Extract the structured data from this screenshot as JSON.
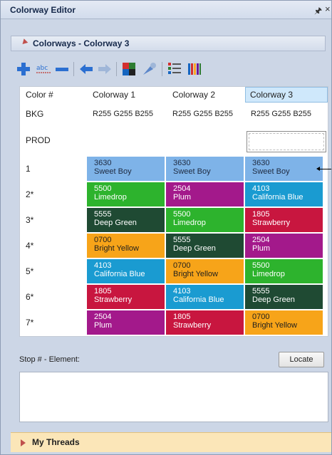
{
  "window": {
    "title": "Colorway Editor",
    "pin_glyph": "1",
    "close_glyph": "×"
  },
  "section": {
    "label": "Colorways - Colorway 3"
  },
  "toolbar": {
    "icons": [
      "add-icon",
      "rename-icon",
      "remove-icon",
      "arrow-left-icon",
      "arrow-right-icon",
      "colorway-grid-icon",
      "color-picker-icon",
      "list-icon",
      "palette-icon"
    ]
  },
  "grid": {
    "headers": [
      "Color #",
      "Colorway 1",
      "Colorway 2",
      "Colorway 3"
    ],
    "bkg": {
      "label": "BKG",
      "values": [
        "R255 G255 B255",
        "R255 G255 B255",
        "R255 G255 B255"
      ]
    },
    "prod": {
      "label": "PROD"
    },
    "rows": [
      {
        "label": "1",
        "cells": [
          {
            "code": "3630",
            "name": "Sweet Boy",
            "color": "#7eb3e8",
            "text": "#1e2a40"
          },
          {
            "code": "3630",
            "name": "Sweet Boy",
            "color": "#7eb3e8",
            "text": "#1e2a40"
          },
          {
            "code": "3630",
            "name": "Sweet Boy",
            "color": "#7eb3e8",
            "text": "#1e2a40"
          }
        ]
      },
      {
        "label": "2*",
        "cells": [
          {
            "code": "5500",
            "name": "Limedrop",
            "color": "#2db32d",
            "text": "#ffffff"
          },
          {
            "code": "2504",
            "name": "Plum",
            "color": "#a3198b",
            "text": "#ffffff"
          },
          {
            "code": "4103",
            "name": "California Blue",
            "color": "#1a9bd1",
            "text": "#ffffff"
          }
        ]
      },
      {
        "label": "3*",
        "cells": [
          {
            "code": "5555",
            "name": "Deep Green",
            "color": "#1f4a33",
            "text": "#ffffff"
          },
          {
            "code": "5500",
            "name": "Limedrop",
            "color": "#2db32d",
            "text": "#ffffff"
          },
          {
            "code": "1805",
            "name": "Strawberry",
            "color": "#c8163f",
            "text": "#ffffff"
          }
        ]
      },
      {
        "label": "4*",
        "cells": [
          {
            "code": "0700",
            "name": "Bright Yellow",
            "color": "#f7a419",
            "text": "#1e1e1e"
          },
          {
            "code": "5555",
            "name": "Deep Green",
            "color": "#1f4a33",
            "text": "#ffffff"
          },
          {
            "code": "2504",
            "name": "Plum",
            "color": "#a3198b",
            "text": "#ffffff"
          }
        ]
      },
      {
        "label": "5*",
        "cells": [
          {
            "code": "4103",
            "name": "California Blue",
            "color": "#1a9bd1",
            "text": "#ffffff"
          },
          {
            "code": "0700",
            "name": "Bright Yellow",
            "color": "#f7a419",
            "text": "#1e1e1e"
          },
          {
            "code": "5500",
            "name": "Limedrop",
            "color": "#2db32d",
            "text": "#ffffff"
          }
        ]
      },
      {
        "label": "6*",
        "cells": [
          {
            "code": "1805",
            "name": "Strawberry",
            "color": "#c8163f",
            "text": "#ffffff"
          },
          {
            "code": "4103",
            "name": "California Blue",
            "color": "#1a9bd1",
            "text": "#ffffff"
          },
          {
            "code": "5555",
            "name": "Deep Green",
            "color": "#1f4a33",
            "text": "#ffffff"
          }
        ]
      },
      {
        "label": "7*",
        "cells": [
          {
            "code": "2504",
            "name": "Plum",
            "color": "#a3198b",
            "text": "#ffffff"
          },
          {
            "code": "1805",
            "name": "Strawberry",
            "color": "#c8163f",
            "text": "#ffffff"
          },
          {
            "code": "0700",
            "name": "Bright Yellow",
            "color": "#f7a419",
            "text": "#1e1e1e"
          }
        ]
      }
    ]
  },
  "stop": {
    "label": "Stop # - Element:",
    "locate_label": "Locate"
  },
  "threads": {
    "label": "My Threads"
  },
  "colors": {
    "accent_red": "#c0504d",
    "selected_header": "#cfe8fb",
    "panel_bg": "#ccd6e6",
    "threads_bg": "#fbe6b8"
  }
}
